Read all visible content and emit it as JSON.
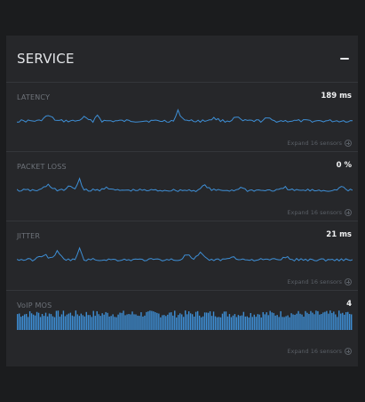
{
  "panel": {
    "title": "SERVICE",
    "collapse_icon": "minus-icon"
  },
  "metrics": [
    {
      "label": "LATENCY",
      "value": "189 ms",
      "expand": "Expand 16 sensors",
      "chart": "line"
    },
    {
      "label": "PACKET LOSS",
      "value": "0 %",
      "expand": "Expand 16 sensors",
      "chart": "line"
    },
    {
      "label": "JITTER",
      "value": "21 ms",
      "expand": "Expand 16 sensors",
      "chart": "line"
    },
    {
      "label": "VoIP MOS",
      "value": "4",
      "expand": "Expand 16 sensors",
      "chart": "bars"
    }
  ],
  "colors": {
    "accent": "#3e8fd6",
    "panel_bg": "#26272a",
    "page_bg": "#1b1c1e"
  }
}
